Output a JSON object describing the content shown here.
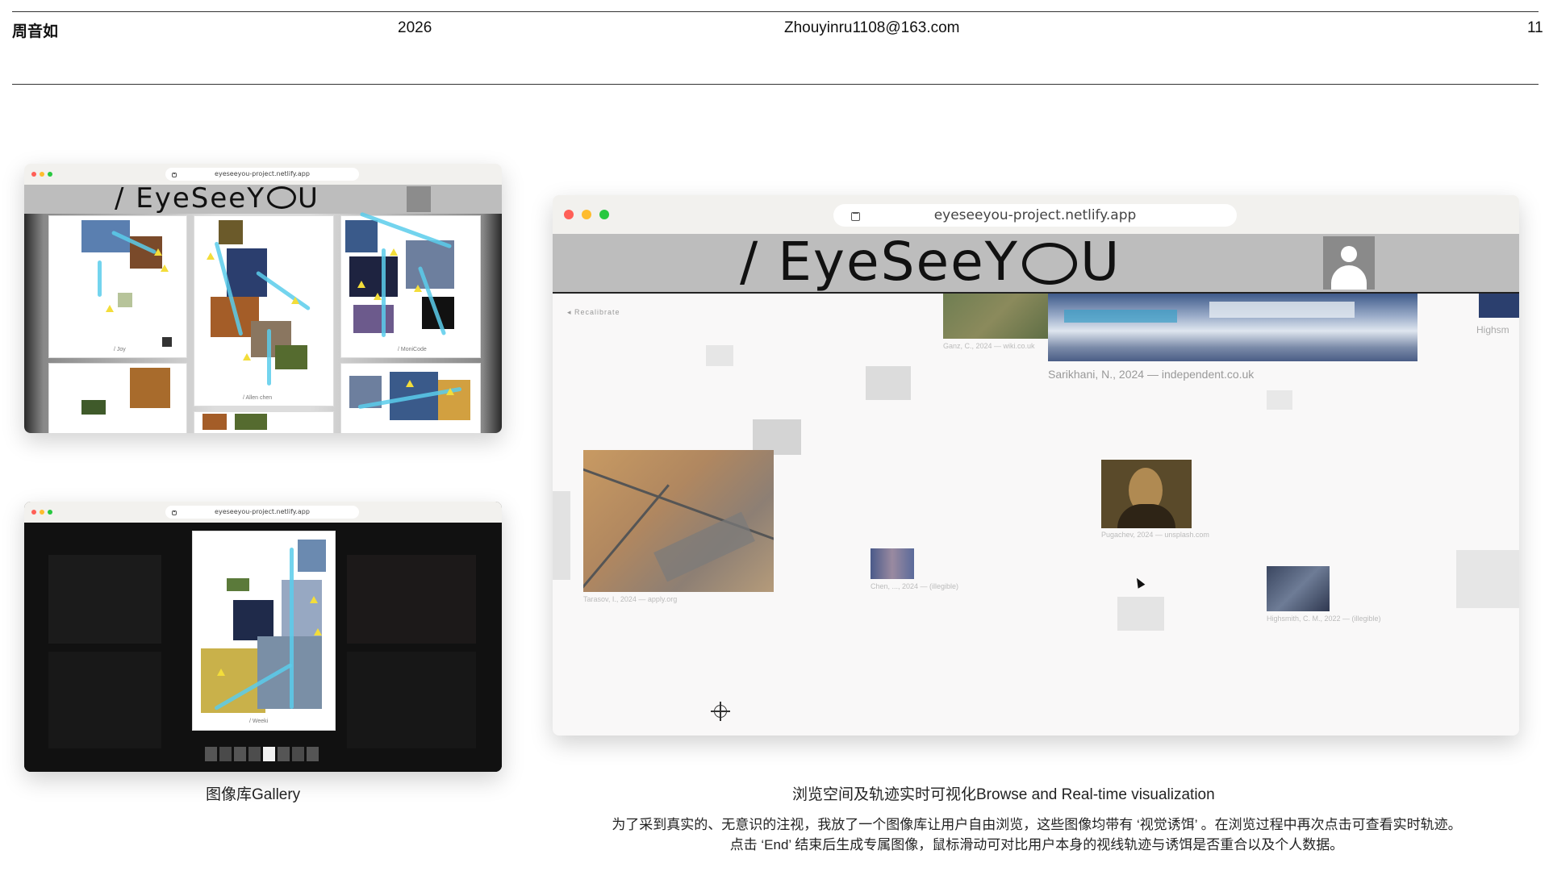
{
  "header": {
    "name": "周音如",
    "year": "2026",
    "email": "Zhouyinru1108@163.com",
    "page_number": "11"
  },
  "app": {
    "url": "eyeseeyou-project.netlify.app",
    "logo": "/ EyeSeeY",
    "logo_tail": "U",
    "recalibrate": "◂ Recalibrate",
    "partial_caption": "Highsm",
    "main_caption": "Sarikhani, N., 2024 — independent.co.uk"
  },
  "small_captions": {
    "field": "Ganz, C., 2024 — wiki.co.uk",
    "desert": "Tarasov, I., 2024 — apply.org",
    "mona": "Pugachev, 2024 — unsplash.com",
    "crowd": "Chen, ..., 2024 — (illegible)",
    "statue": "Highsmith, C. M., 2022 — (illegible)"
  },
  "gallery_cards": {
    "joy": "/ Joy",
    "monicode": "/ MoniCode",
    "allen": "/ Allen chen",
    "weeki": "/ Weeki"
  },
  "captions": {
    "gallery": "图像库Gallery",
    "browse": "浏览空间及轨迹实时可视化Browse and Real-time visualization"
  },
  "description": {
    "line1": "为了采到真实的、无意识的注视，我放了一个图像库让用户自由浏览，这些图像均带有 ‘视觉诱饵’ 。在浏览过程中再次点击可查看实时轨迹。",
    "line2": "点击 ‘End’ 结束后生成专属图像，鼠标滑动可对比用户本身的视线轨迹与诱饵是否重合以及个人数据。"
  },
  "colors": {
    "trace": "#5accea",
    "triangle": "#f3dd3a",
    "traffic_red": "#ff5f57",
    "traffic_yellow": "#febc2e",
    "traffic_green": "#28c840"
  }
}
